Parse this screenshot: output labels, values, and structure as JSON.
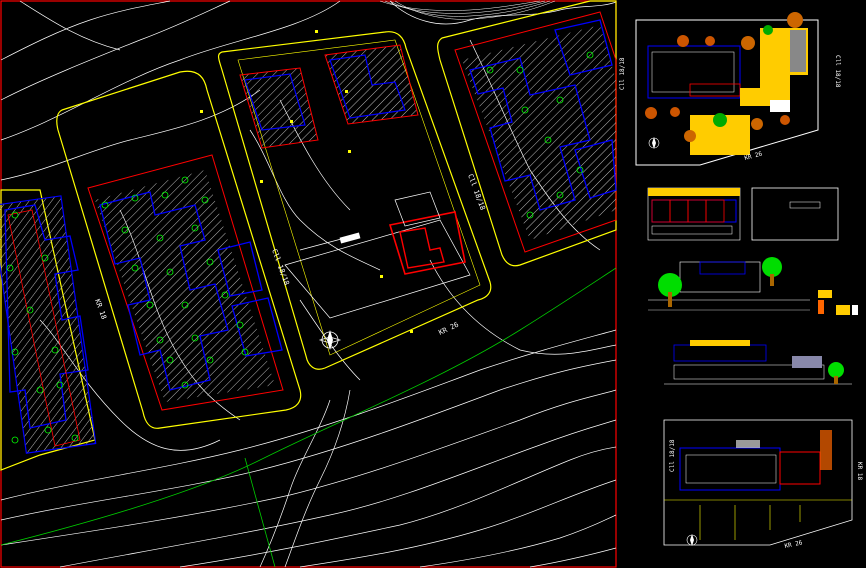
{
  "labels": {
    "street_kr26_main": "KR 26",
    "street_kr26_site": "KR 26",
    "street_kr26_lower": "KR 26",
    "street_cll18_a": "Cll 18/18",
    "street_cll18_b": "Cll 18/18",
    "street_cll18_c": "Cll 18/18",
    "street_cll18_d": "Cll 18/18",
    "street_cll18_e": "Cll 18/18",
    "street_kr18": "KR 18",
    "street_mid": "KR 18"
  },
  "colors": {
    "background": "#000000",
    "frame": "#ff0000",
    "contour": "#ffffff",
    "block_outline": "#ffff00",
    "building": "#0000ff",
    "lot": "#ff0000",
    "hatch": "#cccccc",
    "tree": "#00ff00",
    "road_line": "#00cc00",
    "yellow_fill": "#ffcc00",
    "tree_fill": "#cc6600",
    "green_tree": "#00dd00"
  }
}
